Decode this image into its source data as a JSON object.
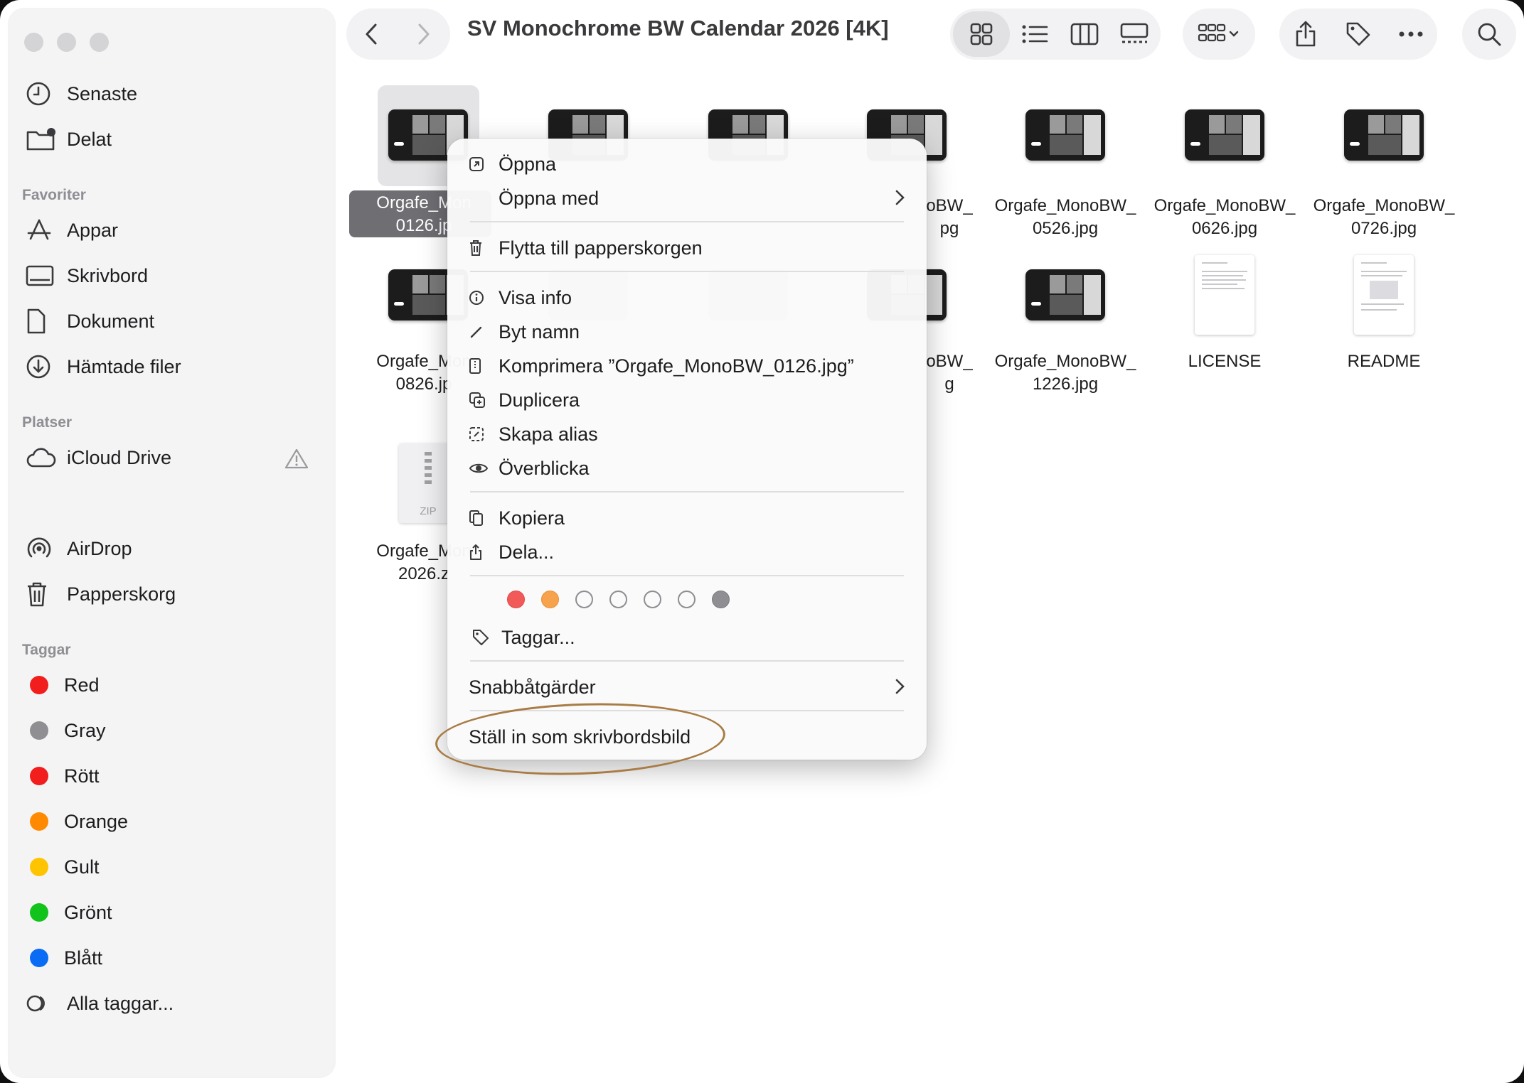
{
  "window": {
    "title": "SV Monochrome BW Calendar 2026 [4K]"
  },
  "sidebar": {
    "top_items": [
      {
        "label": "Senaste",
        "icon": "clock-icon"
      },
      {
        "label": "Delat",
        "icon": "shared-folder-icon"
      }
    ],
    "favorites_heading": "Favoriter",
    "favorites": [
      {
        "label": "Appar",
        "icon": "apps-icon"
      },
      {
        "label": "Skrivbord",
        "icon": "desktop-icon"
      },
      {
        "label": "Dokument",
        "icon": "document-icon"
      },
      {
        "label": "Hämtade filer",
        "icon": "download-icon"
      }
    ],
    "locations_heading": "Platser",
    "locations": [
      {
        "label": "iCloud Drive",
        "icon": "cloud-icon"
      },
      {
        "label": "AirDrop",
        "icon": "airdrop-icon"
      },
      {
        "label": "Papperskorg",
        "icon": "trash-icon"
      }
    ],
    "tags_heading": "Taggar",
    "tags": [
      {
        "label": "Red",
        "color": "#f21d1d"
      },
      {
        "label": "Gray",
        "color": "#8e8e93"
      },
      {
        "label": "Rött",
        "color": "#f21d1d"
      },
      {
        "label": "Orange",
        "color": "#ff8a00"
      },
      {
        "label": "Gult",
        "color": "#ffc400"
      },
      {
        "label": "Grönt",
        "color": "#12c31b"
      },
      {
        "label": "Blått",
        "color": "#0a6cf5"
      }
    ],
    "all_tags": "Alla taggar..."
  },
  "files": {
    "row1": [
      {
        "line1": "Orgafe_Mon",
        "line2": "0126.jp"
      },
      {
        "line1": "oBW_",
        "line2": "pg"
      },
      {
        "line1": "Orgafe_MonoBW_",
        "line2": "0526.jpg"
      },
      {
        "line1": "Orgafe_MonoBW_",
        "line2": "0626.jpg"
      },
      {
        "line1": "Orgafe_MonoBW_",
        "line2": "0726.jpg"
      }
    ],
    "row2": [
      {
        "line1": "Orgafe_Mon",
        "line2": "0826.jp"
      },
      {
        "line1": "oBW_",
        "line2": "g"
      },
      {
        "line1": "Orgafe_MonoBW_",
        "line2": "1226.jpg"
      },
      {
        "line1": "LICENSE",
        "line2": ""
      },
      {
        "line1": "README",
        "line2": ""
      }
    ],
    "row3": [
      {
        "line1": "Orgafe_Mon",
        "line2": "2026.z",
        "badge": "ZIP"
      }
    ]
  },
  "context_menu": {
    "open": "Öppna",
    "open_with": "Öppna med",
    "move_to_trash": "Flytta till papperskorgen",
    "get_info": "Visa info",
    "rename": "Byt namn",
    "compress": "Komprimera ”Orgafe_MonoBW_0126.jpg”",
    "duplicate": "Duplicera",
    "make_alias": "Skapa alias",
    "quick_look": "Överblicka",
    "copy": "Kopiera",
    "share": "Dela...",
    "tag_colors": [
      "#f25a5a",
      "#f7a24c",
      "none",
      "none",
      "none",
      "none",
      "#8e8e93"
    ],
    "tags": "Taggar...",
    "quick_actions": "Snabbåtgärder",
    "set_wallpaper": "Ställ in som skrivbordsbild"
  }
}
